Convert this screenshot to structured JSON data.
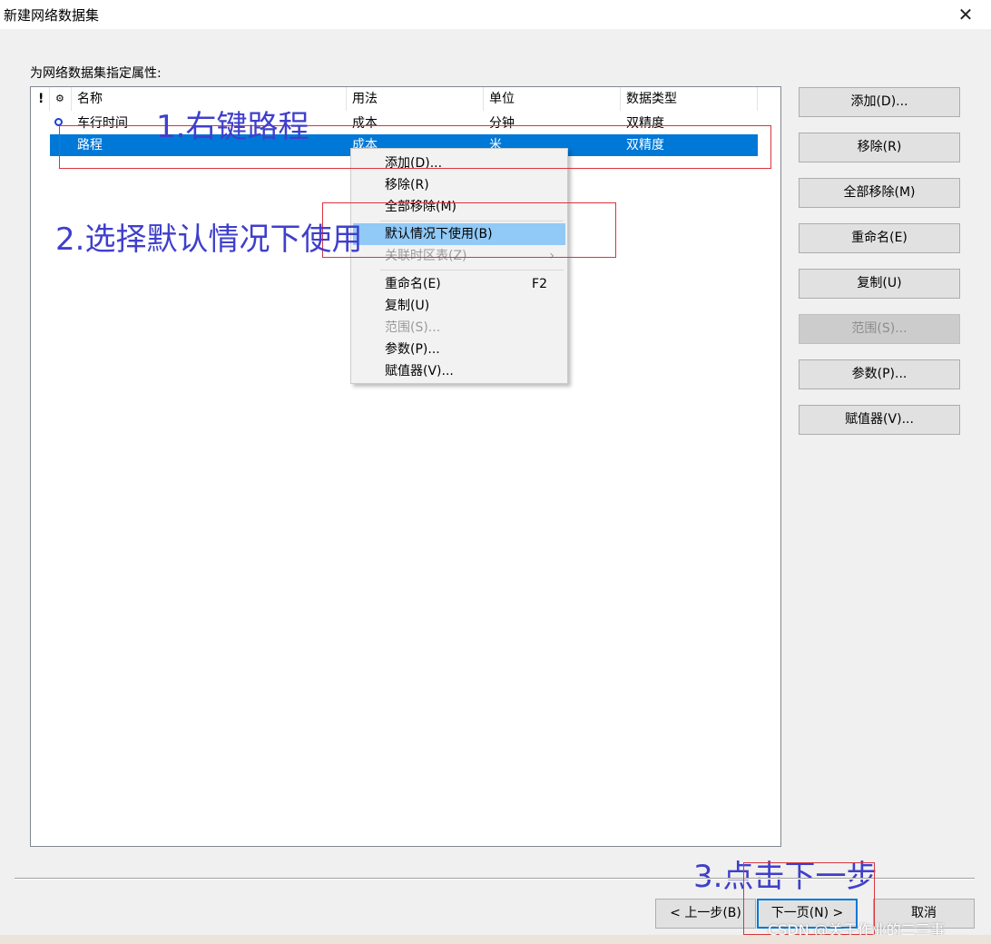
{
  "window": {
    "title": "新建网络数据集",
    "close_glyph": "✕"
  },
  "prop_label": "为网络数据集指定属性:",
  "list": {
    "headers": {
      "flag": "!",
      "default": "⚙",
      "name": "名称",
      "usage": "用法",
      "unit": "单位",
      "type": "数据类型"
    },
    "rows": [
      {
        "name": "车行时间",
        "usage": "成本",
        "unit": "分钟",
        "type": "双精度",
        "default": true,
        "selected": false
      },
      {
        "name": "路程",
        "usage": "成本",
        "unit": "米",
        "type": "双精度",
        "default": false,
        "selected": true
      }
    ]
  },
  "side_buttons": {
    "add": "添加(D)...",
    "remove": "移除(R)",
    "remove_all": "全部移除(M)",
    "rename": "重命名(E)",
    "copy": "复制(U)",
    "range": "范围(S)...",
    "params": "参数(P)...",
    "evaluator": "赋值器(V)..."
  },
  "context_menu": {
    "add": "添加(D)...",
    "remove": "移除(R)",
    "remove_all": "全部移除(M)",
    "use_default": "默认情况下使用(B)",
    "timezone": "关联时区表(Z)",
    "rename": "重命名(E)",
    "rename_shortcut": "F2",
    "copy": "复制(U)",
    "range": "范围(S)...",
    "params": "参数(P)...",
    "evaluator": "赋值器(V)...",
    "submenu_arrow": "›"
  },
  "annotations": {
    "step1": "1.右键路程",
    "step2": "2.选择默认情况下使用",
    "step3": "3.点击下一步"
  },
  "footer": {
    "back": "< 上一步(B)",
    "next": "下一页(N) >",
    "cancel": "取消"
  },
  "watermark": "CSDN @关于作业的二三事",
  "colors": {
    "selection": "#0078d7",
    "menu_highlight": "#91c9f7",
    "annotation_text": "#3f3fcc",
    "annotation_box": "#d9343b"
  }
}
